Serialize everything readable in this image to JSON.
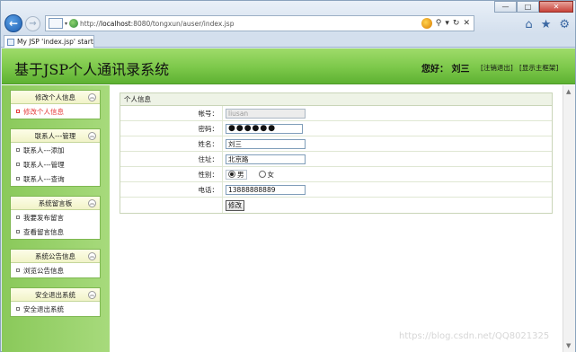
{
  "browser": {
    "url_prefix": "http://",
    "url_host": "localhost",
    "url_rest": ":8080/tongxun/auser/index.jsp",
    "tab_title": "My JSP 'index.jsp' startl...",
    "back_glyph": "←",
    "forward_glyph": "→",
    "window_controls": {
      "minimize": "—",
      "maximize": "□",
      "close": "✕"
    },
    "tab_close": "✕",
    "tool_icons": [
      "home-icon",
      "favorites-star-icon",
      "settings-gear-icon"
    ],
    "tool_glyphs": {
      "home": "⌂",
      "star": "★",
      "gear": "⚙"
    },
    "addr_tool_glyphs": {
      "search": "⚲",
      "dropdown": "▾",
      "refresh": "↻",
      "stop": "✕"
    }
  },
  "header": {
    "title": "基于JSP个人通讯录系统",
    "greeting": "您好：  刘三",
    "logout_link": "[注销退出]",
    "show_frame_link": "[显示主框架]"
  },
  "sidebar": {
    "panels": [
      {
        "title": "修改个人信息",
        "items": [
          {
            "label": "修改个人信息",
            "active": true
          }
        ]
      },
      {
        "title": "联系人---管理",
        "items": [
          {
            "label": "联系人---添加"
          },
          {
            "label": "联系人---管理"
          },
          {
            "label": "联系人---查询"
          }
        ]
      },
      {
        "title": "系统留言板",
        "items": [
          {
            "label": "我要发布留言"
          },
          {
            "label": "查看留言信息"
          }
        ]
      },
      {
        "title": "系统公告信息",
        "items": [
          {
            "label": "浏览公告信息"
          }
        ]
      },
      {
        "title": "安全退出系统",
        "items": [
          {
            "label": "安全退出系统"
          }
        ]
      }
    ],
    "toggle_glyph": "︽"
  },
  "form": {
    "heading": "个人信息",
    "account_label": "帐号：",
    "account_value": "liusan",
    "password_label": "密码：",
    "password_value": "●●●●●●",
    "name_label": "姓名：",
    "name_value": "刘三",
    "address_label": "住址：",
    "address_value": "北京路",
    "gender_label": "性别：",
    "gender_options": [
      {
        "label": "男",
        "checked": true
      },
      {
        "label": "女",
        "checked": false
      }
    ],
    "phone_label": "电话：",
    "phone_value": "13888888889",
    "submit_label": "修改"
  },
  "watermark": "https://blog.csdn.net/QQ8021325"
}
